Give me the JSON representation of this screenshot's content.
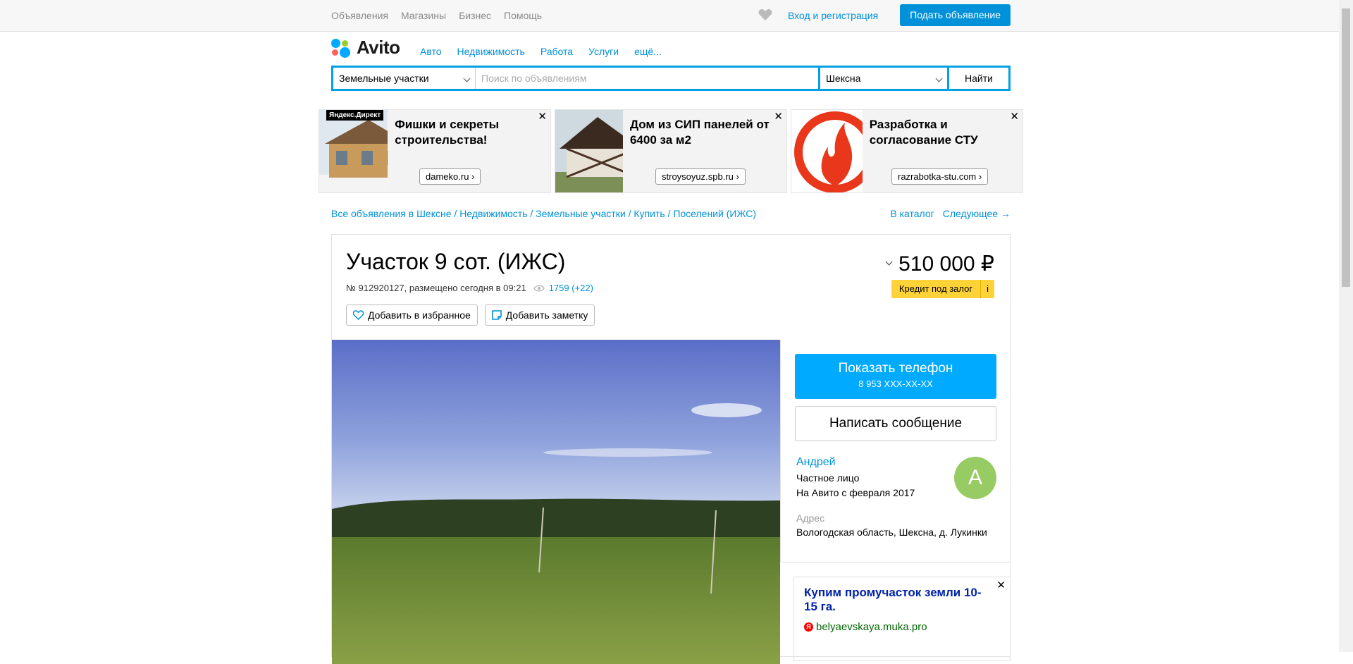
{
  "topbar": {
    "nav": [
      "Объявления",
      "Магазины",
      "Бизнес",
      "Помощь"
    ],
    "login": "Вход и регистрация",
    "post": "Подать объявление"
  },
  "brand": {
    "name": "Avito",
    "colors": [
      "#00aaff",
      "#97cf26",
      "#ff6163",
      "#a169f7"
    ]
  },
  "categories": [
    "Авто",
    "Недвижимость",
    "Работа",
    "Услуги",
    "ещё..."
  ],
  "search": {
    "category": "Земельные участки",
    "placeholder": "Поиск по объявлениям",
    "location": "Шексна",
    "button": "Найти"
  },
  "ads": [
    {
      "badge": "Яндекс.Директ",
      "title": "Фишки и секреты строительства!",
      "link": "dameko.ru ›"
    },
    {
      "title": "Дом из СИП панелей от 6400 за м2",
      "link": "stroysoyuz.spb.ru ›"
    },
    {
      "title": "Разработка и согласование СТУ",
      "link": "razrabotka-stu.com ›"
    }
  ],
  "breadcrumbs": "Все объявления в Шексне / Недвижимость / Земельные участки / Купить / Поселений (ИЖС)",
  "breadcrumb_right": {
    "catalog": "В каталог",
    "next": "Следующее →"
  },
  "listing": {
    "title": "Участок 9 сот. (ИЖС)",
    "meta": "№ 912920127, размещено сегодня в 09:21",
    "views": "1759 (+22)",
    "favorite": "Добавить в избранное",
    "note": "Добавить заметку",
    "price": "510 000 ₽",
    "credit": "Кредит под залог",
    "credit_info": "i"
  },
  "contact": {
    "phone_label": "Показать телефон",
    "phone_mask": "8 953 XXX-XX-XX",
    "message": "Написать сообщение",
    "seller_name": "Андрей",
    "seller_type": "Частное лицо",
    "seller_since": "На Авито с февраля 2017",
    "avatar_letter": "А",
    "address_label": "Адрес",
    "address": "Вологодская область, Шексна, д. Лукинки"
  },
  "side_ad": {
    "title": "Купим промучасток земли 10-15 га.",
    "url": "belyaevskaya.muka.pro"
  }
}
